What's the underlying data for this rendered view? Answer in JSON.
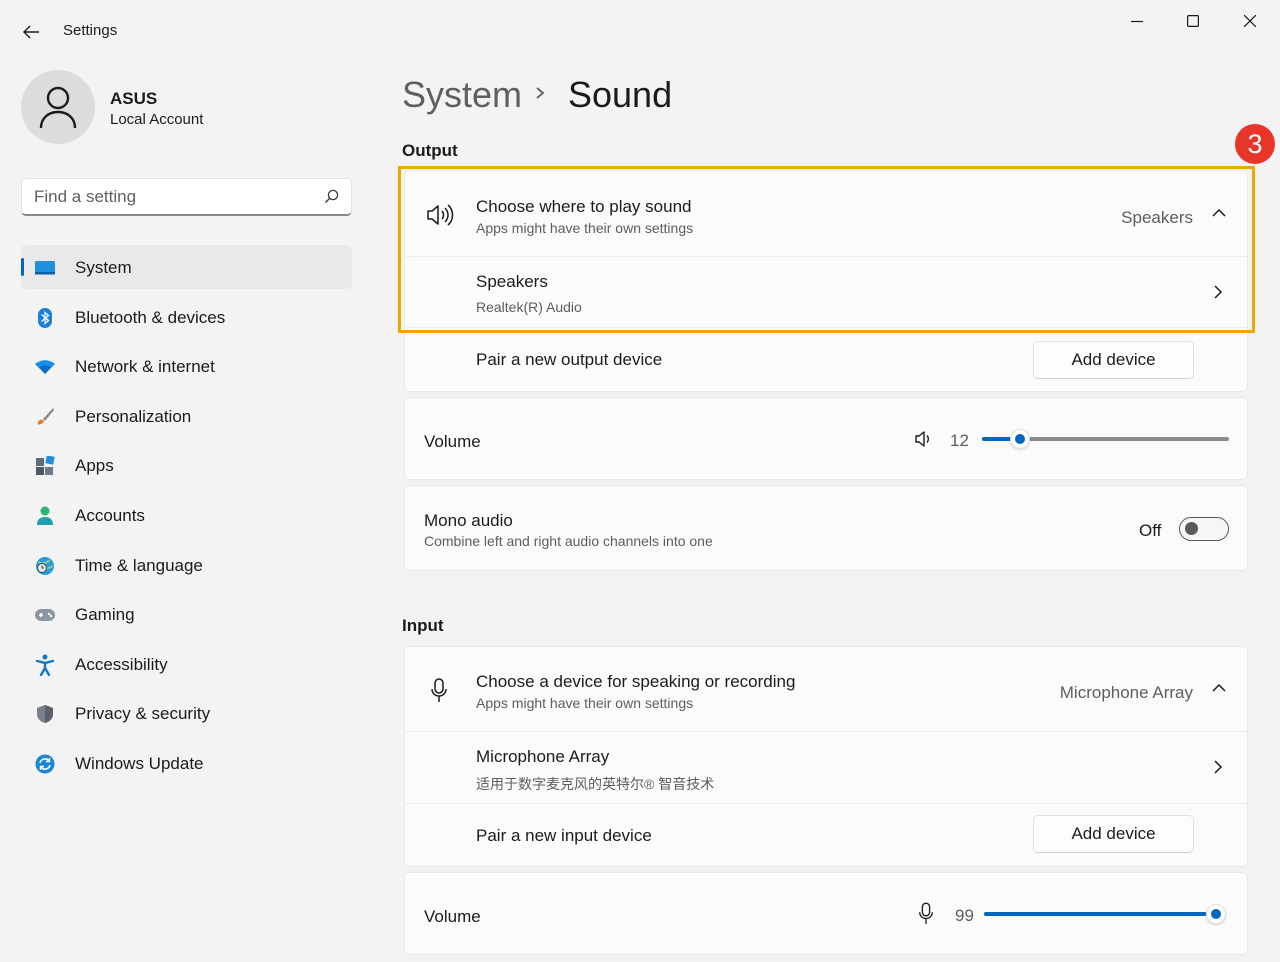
{
  "window": {
    "title": "Settings"
  },
  "account": {
    "name": "ASUS",
    "type": "Local Account"
  },
  "search": {
    "placeholder": "Find a setting"
  },
  "nav": [
    {
      "label": "System",
      "icon": "system-icon",
      "active": true
    },
    {
      "label": "Bluetooth & devices",
      "icon": "bluetooth-icon"
    },
    {
      "label": "Network & internet",
      "icon": "wifi-icon"
    },
    {
      "label": "Personalization",
      "icon": "brush-icon"
    },
    {
      "label": "Apps",
      "icon": "apps-icon"
    },
    {
      "label": "Accounts",
      "icon": "person-icon"
    },
    {
      "label": "Time & language",
      "icon": "globe-clock-icon"
    },
    {
      "label": "Gaming",
      "icon": "gamepad-icon"
    },
    {
      "label": "Accessibility",
      "icon": "accessibility-icon"
    },
    {
      "label": "Privacy & security",
      "icon": "shield-icon"
    },
    {
      "label": "Windows Update",
      "icon": "update-icon"
    }
  ],
  "breadcrumb": {
    "parent": "System",
    "current": "Sound"
  },
  "output": {
    "heading": "Output",
    "choose": {
      "title": "Choose where to play sound",
      "subtitle": "Apps might have their own settings",
      "value": "Speakers"
    },
    "device": {
      "title": "Speakers",
      "subtitle": "Realtek(R) Audio"
    },
    "pair": {
      "title": "Pair a new output device",
      "button": "Add device"
    },
    "volume": {
      "label": "Volume",
      "value": "12"
    },
    "mono": {
      "title": "Mono audio",
      "subtitle": "Combine left and right audio channels into one",
      "state": "Off"
    }
  },
  "input": {
    "heading": "Input",
    "choose": {
      "title": "Choose a device for speaking or recording",
      "subtitle": "Apps might have their own settings",
      "value": "Microphone Array"
    },
    "device": {
      "title": "Microphone Array",
      "subtitle": "适用于数字麦克风的英特尔® 智音技术"
    },
    "pair": {
      "title": "Pair a new input device",
      "button": "Add device"
    },
    "volume": {
      "label": "Volume",
      "value": "99"
    }
  },
  "annotation": {
    "step": "3"
  },
  "colors": {
    "accent": "#0067c0",
    "highlight": "#f0a800",
    "badge": "#e8352a"
  }
}
